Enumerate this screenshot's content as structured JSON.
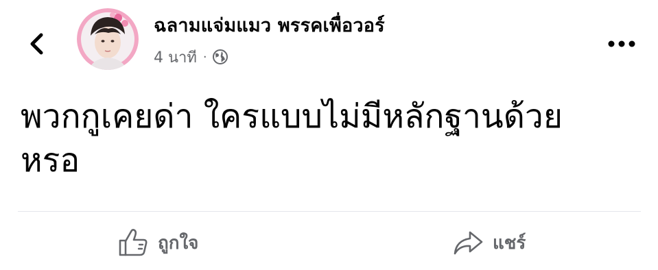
{
  "header": {
    "back_icon": "chevron-left-icon",
    "author_name": "ฉลามแจ่มแมว พรรคเพื่อวอร์",
    "timestamp": "4 นาที",
    "separator": "·",
    "privacy_icon": "globe-icon",
    "more_icon": "ellipsis-icon"
  },
  "post": {
    "text_line1": "พวกกูเคยด่า ใครแบบไม่มีหลักฐานด้วย",
    "text_line2": "หรอ"
  },
  "actions": {
    "like_label": "ถูกใจ",
    "like_icon": "thumbs-up-icon",
    "share_label": "แชร์",
    "share_icon": "share-arrow-icon"
  },
  "colors": {
    "text_primary": "#050505",
    "text_secondary": "#65676b",
    "divider": "#e4e6eb",
    "avatar_ring": "#f0a0c0"
  }
}
